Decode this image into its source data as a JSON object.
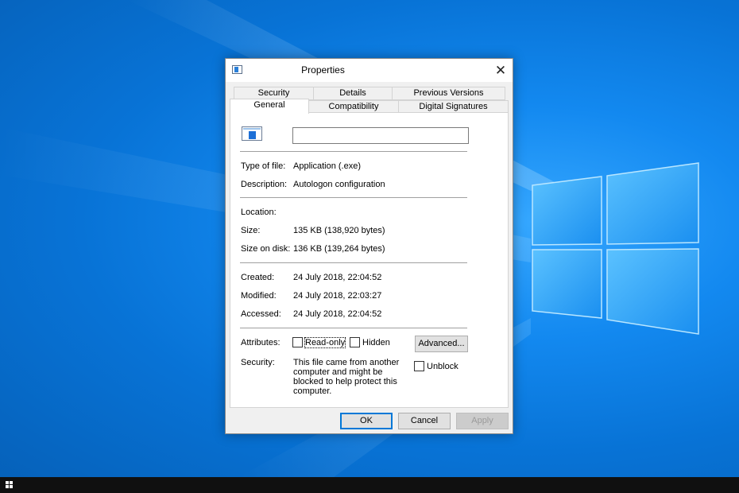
{
  "window": {
    "title": "Properties"
  },
  "tabs_back": [
    "Security",
    "Details",
    "Previous Versions"
  ],
  "tabs_front": [
    "General",
    "Compatibility",
    "Digital Signatures"
  ],
  "general": {
    "file_name_value": "",
    "type_label": "Type of file:",
    "type_value": "Application (.exe)",
    "description_label": "Description:",
    "description_value": "Autologon configuration",
    "location_label": "Location:",
    "location_value": "",
    "size_label": "Size:",
    "size_value": "135 KB (138,920 bytes)",
    "size_on_disk_label": "Size on disk:",
    "size_on_disk_value": "136 KB (139,264 bytes)",
    "created_label": "Created:",
    "created_value": "24 July 2018, 22:04:52",
    "modified_label": "Modified:",
    "modified_value": "24 July 2018, 22:03:27",
    "accessed_label": "Accessed:",
    "accessed_value": "24 July 2018, 22:04:52",
    "attributes_label": "Attributes:",
    "readonly_label": "Read-only",
    "hidden_label": "Hidden",
    "advanced_label": "Advanced...",
    "security_label": "Security:",
    "security_text": "This file came from another computer and might be blocked to help protect this computer.",
    "unblock_label": "Unblock"
  },
  "buttons": {
    "ok": "OK",
    "cancel": "Cancel",
    "apply": "Apply"
  },
  "colors": {
    "accent": "#0078d7",
    "desktop": "#0a78e0"
  },
  "icons": {
    "app": "application-icon",
    "close": "close-icon",
    "start": "windows-start-icon"
  }
}
